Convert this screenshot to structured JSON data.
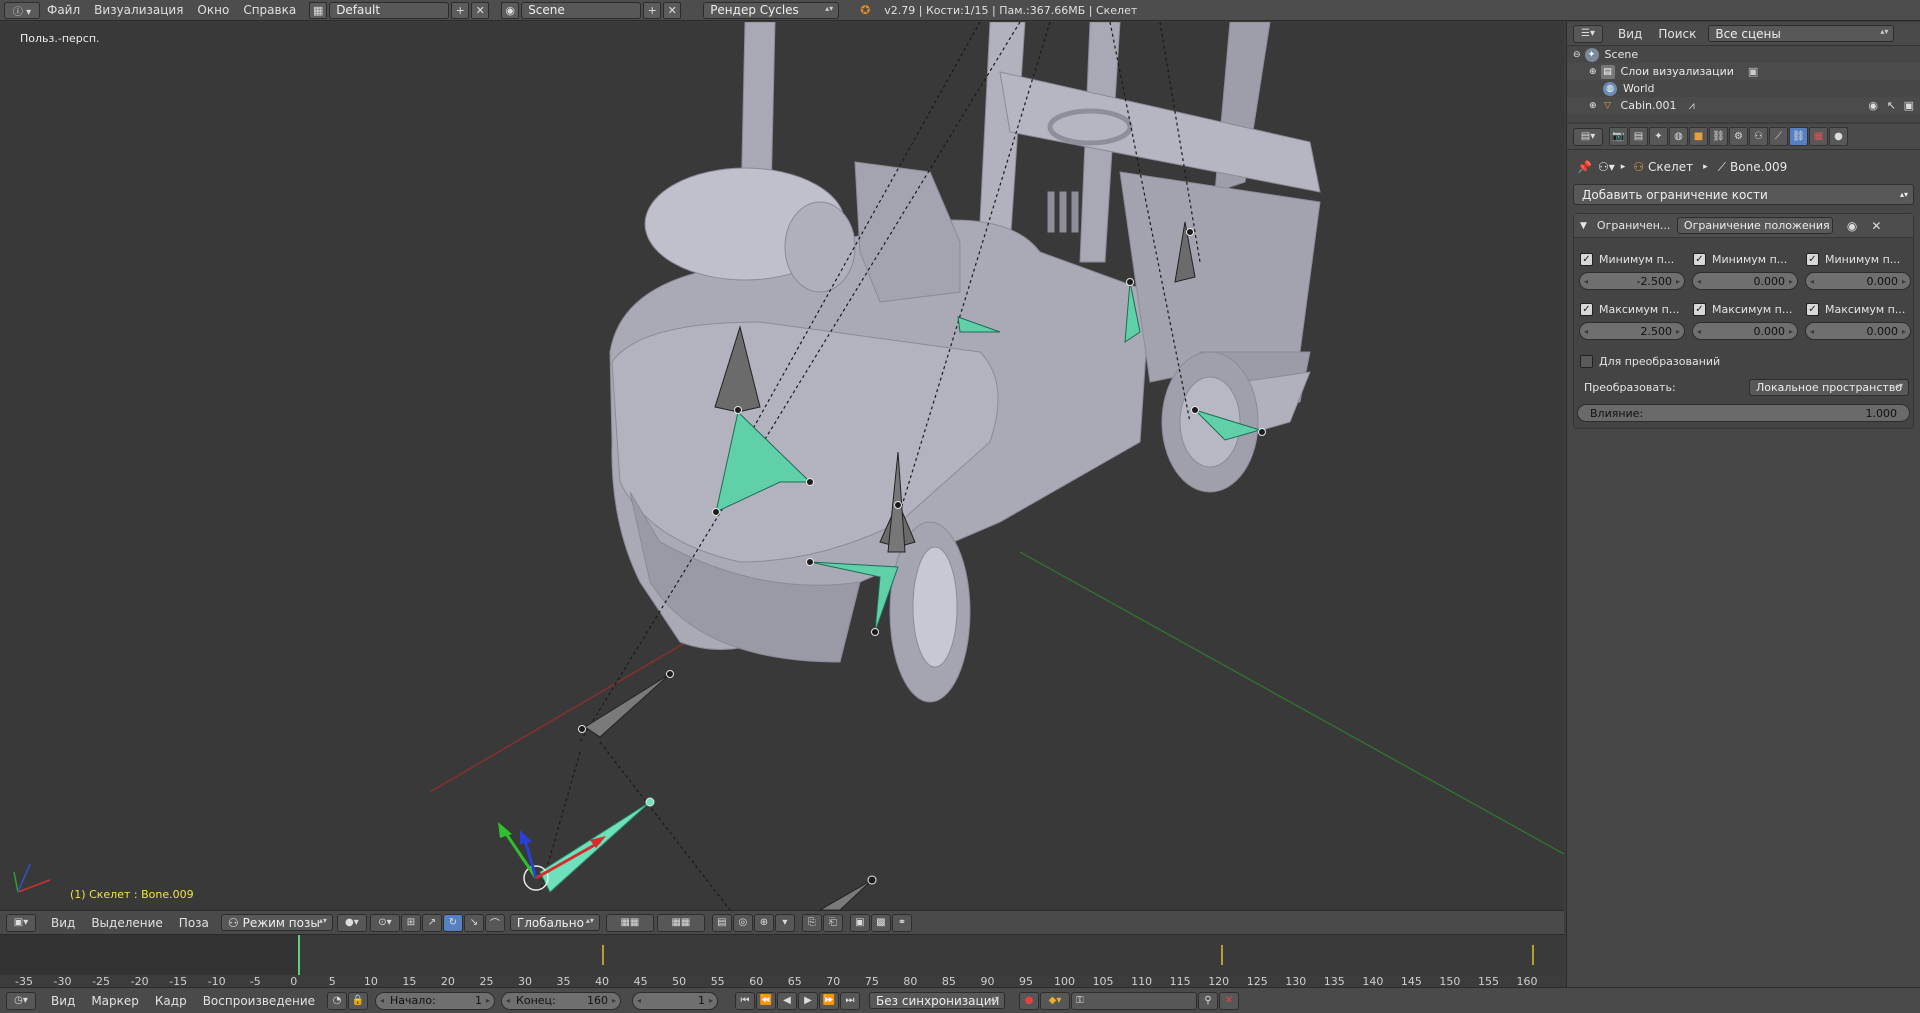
{
  "topbar": {
    "menus": [
      "Файл",
      "Визуализация",
      "Окно",
      "Справка"
    ],
    "layout": "Default",
    "scene": "Scene",
    "render_engine": "Рендер Cycles",
    "stats": "v2.79 | Кости:1/15  | Пам.:367.66МБ | Скелет"
  },
  "viewport": {
    "title": "Польз.-персп.",
    "status": "(1) Скелет : Bone.009"
  },
  "viewport_header": {
    "menus": [
      "Вид",
      "Выделение",
      "Поза"
    ],
    "mode": "Режим позы",
    "orientation": "Глобально"
  },
  "timeline": {
    "ticks": [
      "-35",
      "-30",
      "-25",
      "-20",
      "-15",
      "-10",
      "-5",
      "0",
      "5",
      "10",
      "15",
      "20",
      "25",
      "30",
      "35",
      "40",
      "45",
      "50",
      "55",
      "60",
      "65",
      "70",
      "75",
      "80",
      "85",
      "90",
      "95",
      "100",
      "105",
      "110",
      "115",
      "120",
      "125",
      "130",
      "135",
      "140",
      "145",
      "150",
      "155",
      "160"
    ],
    "menus": [
      "Вид",
      "Маркер",
      "Кадр",
      "Воспроизведение"
    ],
    "start_label": "Начало:",
    "start": "1",
    "end_label": "Конец:",
    "end": "160",
    "current": "1",
    "sync": "Без синхронизации"
  },
  "outliner": {
    "menus": [
      "Вид",
      "Поиск"
    ],
    "filter": "Все сцены",
    "rows": [
      "Scene",
      "Слои визуализации",
      "World",
      "Cabin.001"
    ]
  },
  "properties": {
    "breadcrumb": [
      "Скелет",
      "Bone.009"
    ],
    "add_constraint": "Добавить ограничение кости",
    "constraint": {
      "name": "Ограничен...",
      "type": "Ограничение положения",
      "min_labels": [
        "Минимум п...",
        "Минимум п...",
        "Минимум п..."
      ],
      "min_values": [
        "-2.500",
        "0.000",
        "0.000"
      ],
      "max_labels": [
        "Максимум п...",
        "Максимум п...",
        "Максимум п..."
      ],
      "max_values": [
        "2.500",
        "0.000",
        "0.000"
      ],
      "for_transform": "Для преобразований",
      "convert_label": "Преобразовать:",
      "convert_value": "Локальное пространство",
      "influence_label": "Влияние:",
      "influence_value": "1.000"
    }
  },
  "colors": {
    "viewport_bg": "#393939",
    "model": "#a9a9b6",
    "bone_selected": "#5fd0a8",
    "bone_idle": "#6a6a6a",
    "active_tab": "#5680c2",
    "status_text": "#f0e442"
  }
}
